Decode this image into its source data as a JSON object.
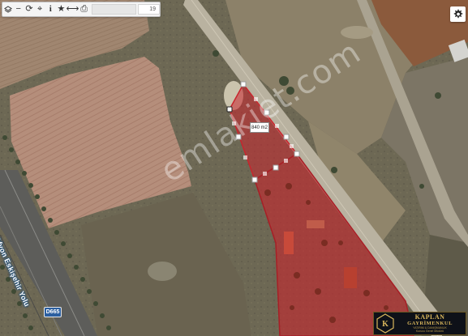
{
  "toolbar": {
    "tools": [
      {
        "name": "zoom-out-button",
        "icon": "minus-icon",
        "glyph": "−"
      },
      {
        "name": "refresh-button",
        "icon": "refresh-icon",
        "glyph": "⟳"
      },
      {
        "name": "locate-button",
        "icon": "crosshair-icon",
        "glyph": "⌖"
      },
      {
        "name": "info-button",
        "icon": "info-icon",
        "glyph": "i"
      },
      {
        "name": "favorite-button",
        "icon": "star-icon",
        "glyph": "★"
      },
      {
        "name": "measure-button",
        "icon": "ruler-icon",
        "glyph": "⟷"
      },
      {
        "name": "print-button",
        "icon": "printer-icon",
        "glyph": "⎙"
      }
    ],
    "zoom_level": "19"
  },
  "parcel": {
    "area_label": "840 m2",
    "fill_color": "#c8252d"
  },
  "road": {
    "name": "Afyon Eskişehir Yolu",
    "shield": "D665",
    "shield_color": "#2b5fa0"
  },
  "watermark": {
    "text": "emlakjet.com"
  },
  "badge": {
    "line1": "KAPLAN",
    "line2": "GAYRİMENKUL",
    "line3": "YATIRIM & DANIŞMANLIK",
    "line4": "Kurucu Genel Müdürü",
    "accent_color": "#d8b65c"
  }
}
